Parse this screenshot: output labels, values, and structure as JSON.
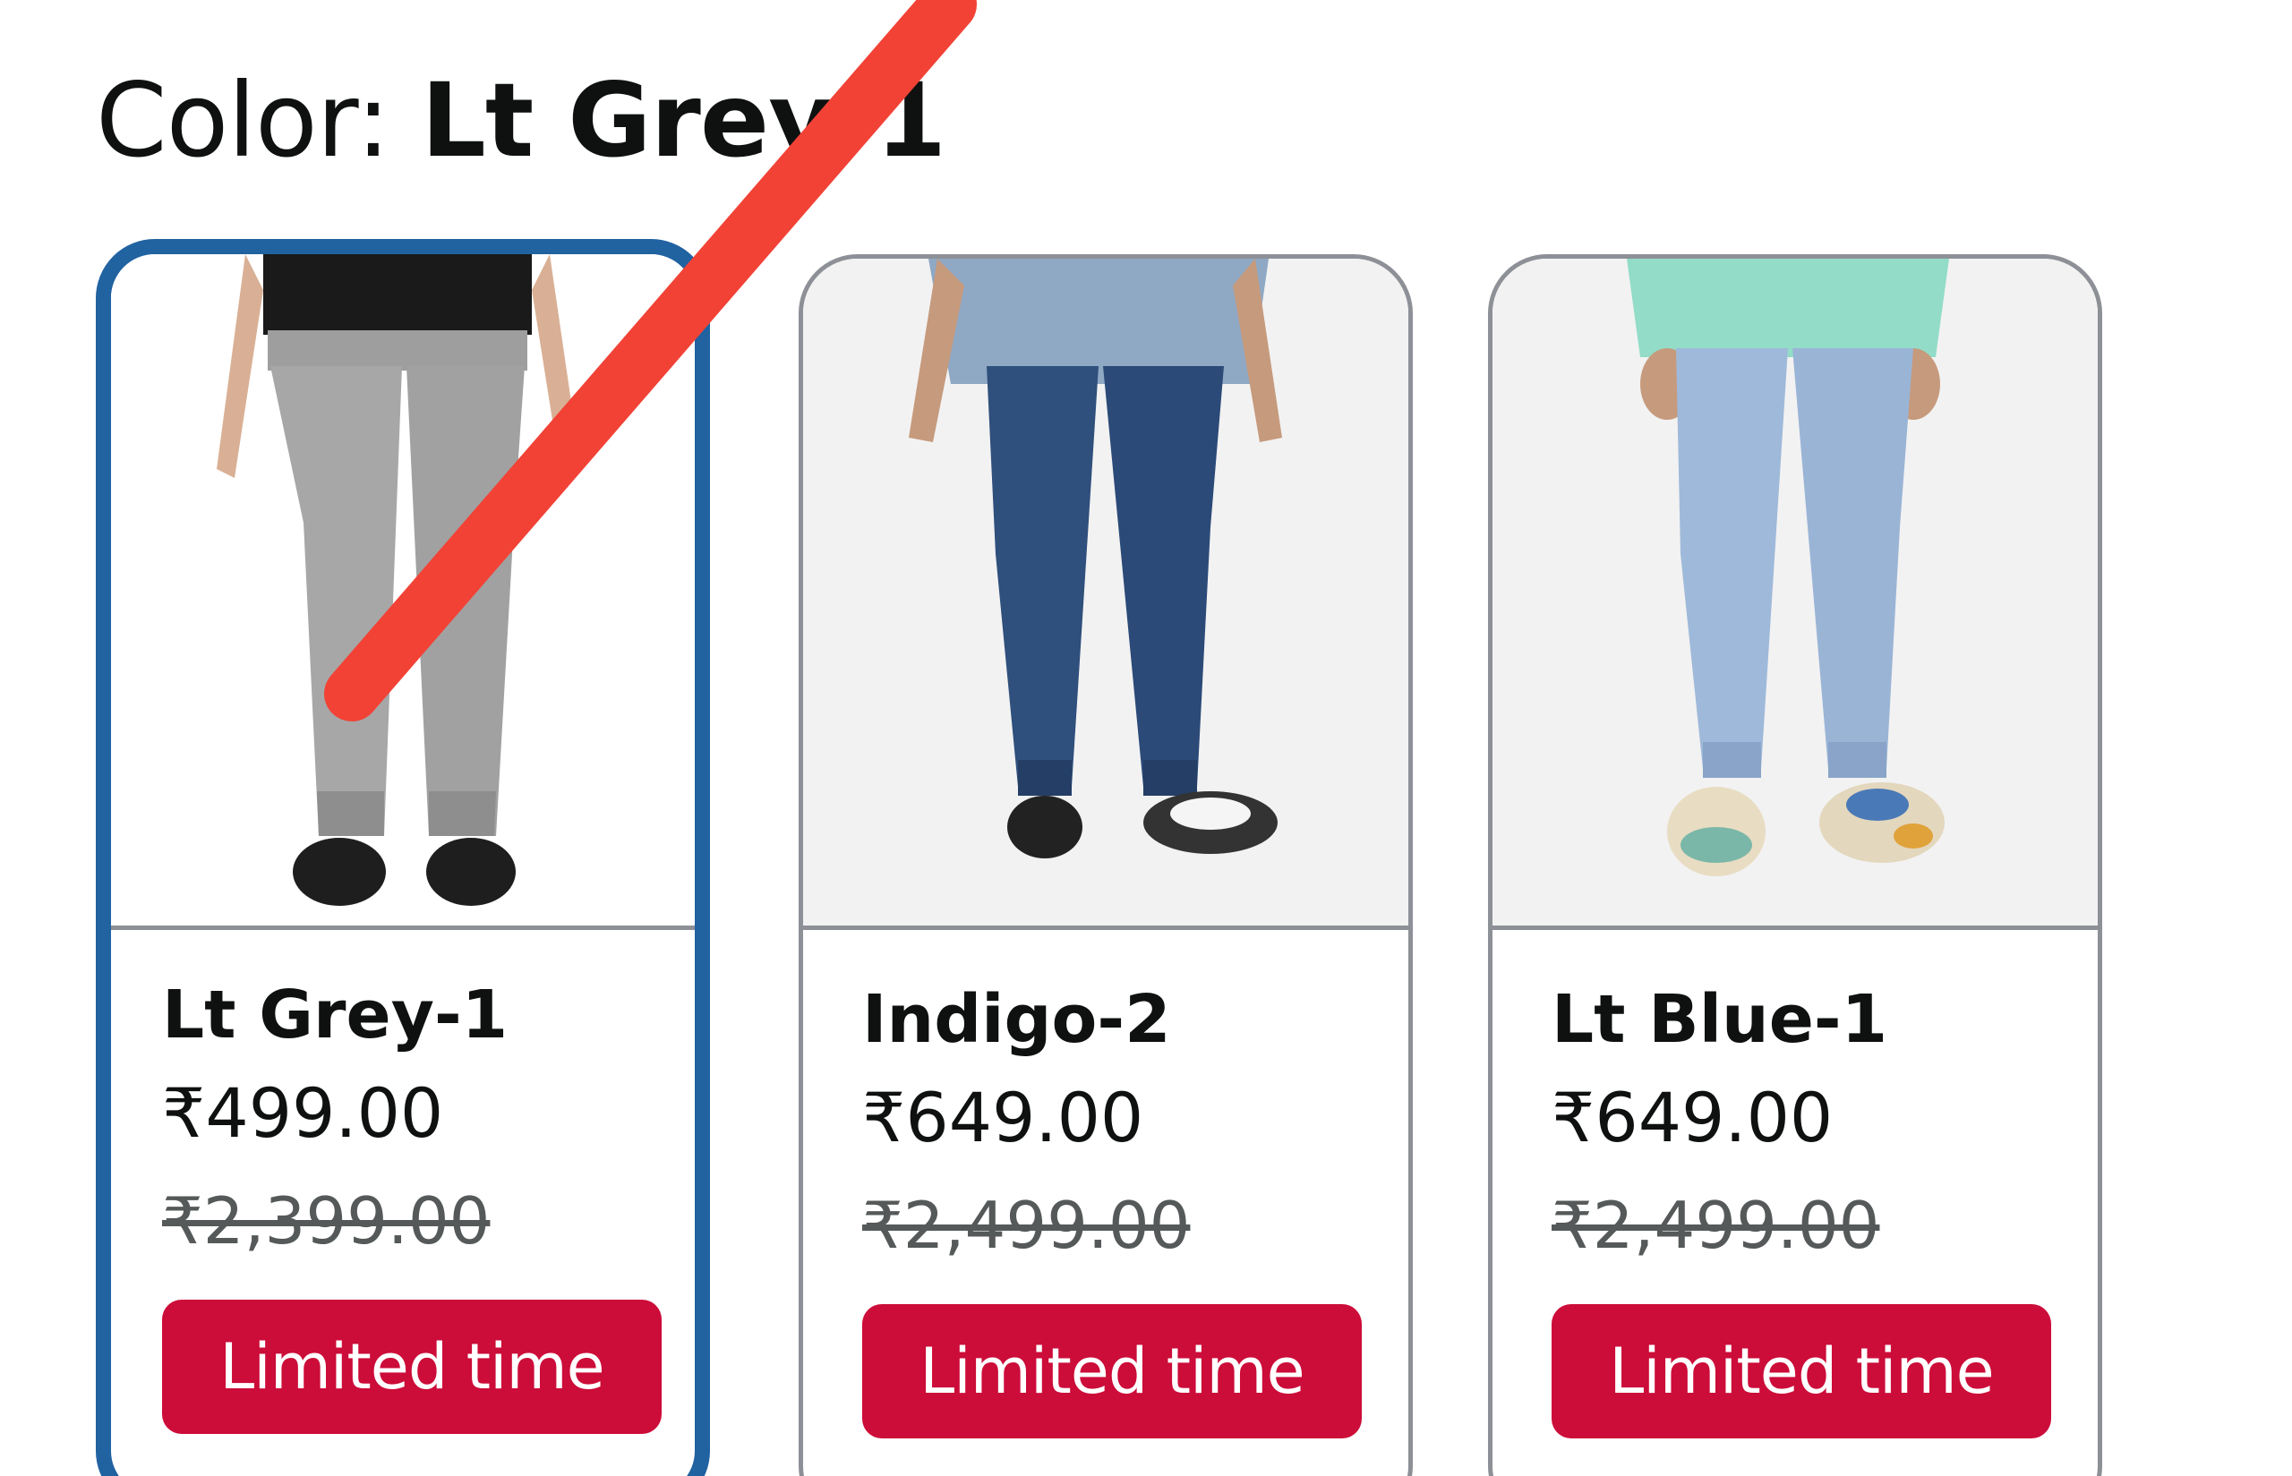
{
  "color_selector": {
    "label": "Color: ",
    "selected_value": "Lt Grey-1"
  },
  "variants": [
    {
      "name": "Lt Grey-1",
      "price": "₹499.00",
      "list_price": "₹2,399.00",
      "deal_badge": "Limited time",
      "selected": true
    },
    {
      "name": "Indigo-2",
      "price": "₹649.00",
      "list_price": "₹2,499.00",
      "deal_badge": "Limited time",
      "selected": false
    },
    {
      "name": "Lt Blue-1",
      "price": "₹649.00",
      "list_price": "₹2,499.00",
      "deal_badge": "Limited time",
      "selected": false
    }
  ],
  "colors": {
    "selected_border": "#2162a1",
    "card_border": "#8d9096",
    "deal_badge_bg": "#cc0c39",
    "annotation_stroke": "#f24236"
  },
  "icons": {
    "annotation": "red-strike-annotation"
  }
}
